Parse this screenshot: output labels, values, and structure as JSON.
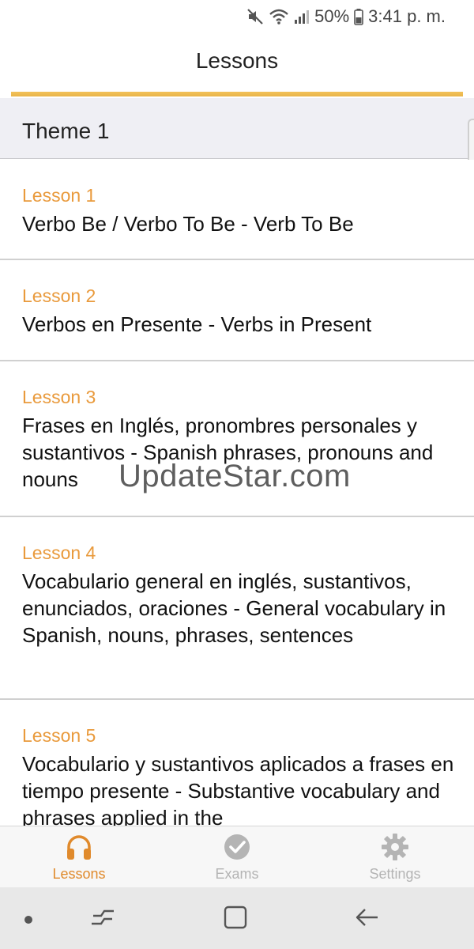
{
  "status_bar": {
    "battery_percent": "50%",
    "time": "3:41 p. m."
  },
  "header": {
    "title": "Lessons"
  },
  "theme": {
    "title": "Theme 1"
  },
  "lessons": [
    {
      "label": "Lesson 1",
      "desc": "Verbo Be / Verbo To Be - Verb To Be"
    },
    {
      "label": "Lesson 2",
      "desc": "Verbos en Presente - Verbs in Present"
    },
    {
      "label": "Lesson 3",
      "desc": "Frases en Inglés, pronombres personales y sustantivos - Spanish phrases, pronouns and nouns"
    },
    {
      "label": "Lesson 4",
      "desc": "Vocabulario general en inglés, sustantivos, enunciados, oraciones - General vocabulary in Spanish, nouns, phrases, sentences"
    },
    {
      "label": "Lesson 5",
      "desc": "Vocabulario y sustantivos aplicados a frases en tiempo presente - Substantive vocabulary and phrases applied in the"
    }
  ],
  "watermark": "UpdateStar.com",
  "tabs": [
    {
      "label": "Lessons",
      "icon": "headphones-icon",
      "active": true
    },
    {
      "label": "Exams",
      "icon": "checkmark-circle-icon",
      "active": false
    },
    {
      "label": "Settings",
      "icon": "gear-icon",
      "active": false
    }
  ],
  "colors": {
    "accent": "#e99a3c",
    "accent_bar": "#f2c159",
    "inactive_tab": "#b4b4b4"
  }
}
